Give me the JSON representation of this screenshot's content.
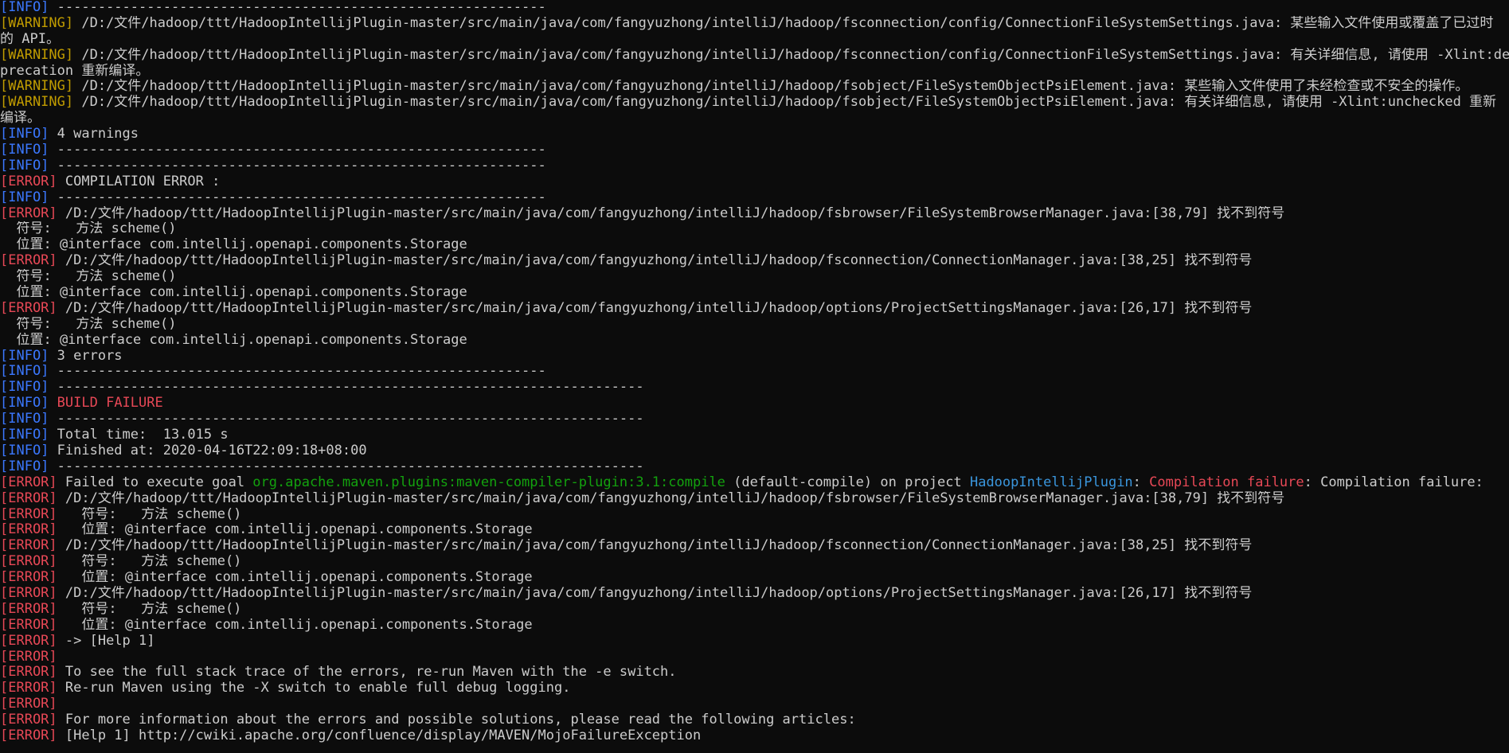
{
  "colors": {
    "background": "#0c0c0c",
    "text": "#cccccc",
    "info": "#3b78ff",
    "warning": "#c19c00",
    "error": "#e74856",
    "green": "#13a10e",
    "cyan": "#3a96dd"
  },
  "lines": [
    [
      {
        "c": "info",
        "t": "[INFO]"
      },
      {
        "c": "",
        "t": " ------------------------------------------------------------"
      }
    ],
    [
      {
        "c": "warn",
        "t": "[WARNING]"
      },
      {
        "c": "",
        "t": " /D:/文件/hadoop/ttt/HadoopIntellijPlugin-master/src/main/java/com/fangyuzhong/intelliJ/hadoop/fsconnection/config/ConnectionFileSystemSettings.java: 某些输入文件使用或覆盖了已过时"
      }
    ],
    [
      {
        "c": "",
        "t": "的 API。"
      }
    ],
    [
      {
        "c": "warn",
        "t": "[WARNING]"
      },
      {
        "c": "",
        "t": " /D:/文件/hadoop/ttt/HadoopIntellijPlugin-master/src/main/java/com/fangyuzhong/intelliJ/hadoop/fsconnection/config/ConnectionFileSystemSettings.java: 有关详细信息, 请使用 -Xlint:de"
      }
    ],
    [
      {
        "c": "",
        "t": "precation 重新编译。"
      }
    ],
    [
      {
        "c": "warn",
        "t": "[WARNING]"
      },
      {
        "c": "",
        "t": " /D:/文件/hadoop/ttt/HadoopIntellijPlugin-master/src/main/java/com/fangyuzhong/intelliJ/hadoop/fsobject/FileSystemObjectPsiElement.java: 某些输入文件使用了未经检查或不安全的操作。"
      }
    ],
    [
      {
        "c": "warn",
        "t": "[WARNING]"
      },
      {
        "c": "",
        "t": " /D:/文件/hadoop/ttt/HadoopIntellijPlugin-master/src/main/java/com/fangyuzhong/intelliJ/hadoop/fsobject/FileSystemObjectPsiElement.java: 有关详细信息, 请使用 -Xlint:unchecked 重新"
      }
    ],
    [
      {
        "c": "",
        "t": "编译。"
      }
    ],
    [
      {
        "c": "info",
        "t": "[INFO]"
      },
      {
        "c": "",
        "t": " 4 warnings"
      }
    ],
    [
      {
        "c": "info",
        "t": "[INFO]"
      },
      {
        "c": "",
        "t": " ------------------------------------------------------------"
      }
    ],
    [
      {
        "c": "info",
        "t": "[INFO]"
      },
      {
        "c": "",
        "t": " ------------------------------------------------------------"
      }
    ],
    [
      {
        "c": "error",
        "t": "[ERROR]"
      },
      {
        "c": "",
        "t": " COMPILATION ERROR :"
      }
    ],
    [
      {
        "c": "info",
        "t": "[INFO]"
      },
      {
        "c": "",
        "t": " ------------------------------------------------------------"
      }
    ],
    [
      {
        "c": "error",
        "t": "[ERROR]"
      },
      {
        "c": "",
        "t": " /D:/文件/hadoop/ttt/HadoopIntellijPlugin-master/src/main/java/com/fangyuzhong/intelliJ/hadoop/fsbrowser/FileSystemBrowserManager.java:[38,79] 找不到符号"
      }
    ],
    [
      {
        "c": "",
        "t": "  符号:   方法 scheme()"
      }
    ],
    [
      {
        "c": "",
        "t": "  位置: @interface com.intellij.openapi.components.Storage"
      }
    ],
    [
      {
        "c": "error",
        "t": "[ERROR]"
      },
      {
        "c": "",
        "t": " /D:/文件/hadoop/ttt/HadoopIntellijPlugin-master/src/main/java/com/fangyuzhong/intelliJ/hadoop/fsconnection/ConnectionManager.java:[38,25] 找不到符号"
      }
    ],
    [
      {
        "c": "",
        "t": "  符号:   方法 scheme()"
      }
    ],
    [
      {
        "c": "",
        "t": "  位置: @interface com.intellij.openapi.components.Storage"
      }
    ],
    [
      {
        "c": "error",
        "t": "[ERROR]"
      },
      {
        "c": "",
        "t": " /D:/文件/hadoop/ttt/HadoopIntellijPlugin-master/src/main/java/com/fangyuzhong/intelliJ/hadoop/options/ProjectSettingsManager.java:[26,17] 找不到符号"
      }
    ],
    [
      {
        "c": "",
        "t": "  符号:   方法 scheme()"
      }
    ],
    [
      {
        "c": "",
        "t": "  位置: @interface com.intellij.openapi.components.Storage"
      }
    ],
    [
      {
        "c": "info",
        "t": "[INFO]"
      },
      {
        "c": "",
        "t": " 3 errors"
      }
    ],
    [
      {
        "c": "info",
        "t": "[INFO]"
      },
      {
        "c": "",
        "t": " ------------------------------------------------------------"
      }
    ],
    [
      {
        "c": "info",
        "t": "[INFO]"
      },
      {
        "c": "",
        "t": " ------------------------------------------------------------------------"
      }
    ],
    [
      {
        "c": "info",
        "t": "[INFO]"
      },
      {
        "c": "",
        "t": " "
      },
      {
        "c": "bright-red",
        "t": "BUILD FAILURE"
      }
    ],
    [
      {
        "c": "info",
        "t": "[INFO]"
      },
      {
        "c": "",
        "t": " ------------------------------------------------------------------------"
      }
    ],
    [
      {
        "c": "info",
        "t": "[INFO]"
      },
      {
        "c": "",
        "t": " Total time:  13.015 s"
      }
    ],
    [
      {
        "c": "info",
        "t": "[INFO]"
      },
      {
        "c": "",
        "t": " Finished at: 2020-04-16T22:09:18+08:00"
      }
    ],
    [
      {
        "c": "info",
        "t": "[INFO]"
      },
      {
        "c": "",
        "t": " ------------------------------------------------------------------------"
      }
    ],
    [
      {
        "c": "error",
        "t": "[ERROR]"
      },
      {
        "c": "",
        "t": " Failed to execute goal "
      },
      {
        "c": "green",
        "t": "org.apache.maven.plugins:maven-compiler-plugin:3.1:compile"
      },
      {
        "c": "",
        "t": " (default-compile) on project "
      },
      {
        "c": "cyan",
        "t": "HadoopIntellijPlugin"
      },
      {
        "c": "",
        "t": ": "
      },
      {
        "c": "bright-red",
        "t": "Compilation failure"
      },
      {
        "c": "",
        "t": ": Compilation failure:"
      }
    ],
    [
      {
        "c": "error",
        "t": "[ERROR]"
      },
      {
        "c": "",
        "t": " /D:/文件/hadoop/ttt/HadoopIntellijPlugin-master/src/main/java/com/fangyuzhong/intelliJ/hadoop/fsbrowser/FileSystemBrowserManager.java:[38,79] 找不到符号"
      }
    ],
    [
      {
        "c": "error",
        "t": "[ERROR]"
      },
      {
        "c": "",
        "t": "   符号:   方法 scheme()"
      }
    ],
    [
      {
        "c": "error",
        "t": "[ERROR]"
      },
      {
        "c": "",
        "t": "   位置: @interface com.intellij.openapi.components.Storage"
      }
    ],
    [
      {
        "c": "error",
        "t": "[ERROR]"
      },
      {
        "c": "",
        "t": " /D:/文件/hadoop/ttt/HadoopIntellijPlugin-master/src/main/java/com/fangyuzhong/intelliJ/hadoop/fsconnection/ConnectionManager.java:[38,25] 找不到符号"
      }
    ],
    [
      {
        "c": "error",
        "t": "[ERROR]"
      },
      {
        "c": "",
        "t": "   符号:   方法 scheme()"
      }
    ],
    [
      {
        "c": "error",
        "t": "[ERROR]"
      },
      {
        "c": "",
        "t": "   位置: @interface com.intellij.openapi.components.Storage"
      }
    ],
    [
      {
        "c": "error",
        "t": "[ERROR]"
      },
      {
        "c": "",
        "t": " /D:/文件/hadoop/ttt/HadoopIntellijPlugin-master/src/main/java/com/fangyuzhong/intelliJ/hadoop/options/ProjectSettingsManager.java:[26,17] 找不到符号"
      }
    ],
    [
      {
        "c": "error",
        "t": "[ERROR]"
      },
      {
        "c": "",
        "t": "   符号:   方法 scheme()"
      }
    ],
    [
      {
        "c": "error",
        "t": "[ERROR]"
      },
      {
        "c": "",
        "t": "   位置: @interface com.intellij.openapi.components.Storage"
      }
    ],
    [
      {
        "c": "error",
        "t": "[ERROR]"
      },
      {
        "c": "",
        "t": " -> [Help 1]"
      }
    ],
    [
      {
        "c": "error",
        "t": "[ERROR]"
      }
    ],
    [
      {
        "c": "error",
        "t": "[ERROR]"
      },
      {
        "c": "",
        "t": " To see the full stack trace of the errors, re-run Maven with the -e switch."
      }
    ],
    [
      {
        "c": "error",
        "t": "[ERROR]"
      },
      {
        "c": "",
        "t": " Re-run Maven using the -X switch to enable full debug logging."
      }
    ],
    [
      {
        "c": "error",
        "t": "[ERROR]"
      }
    ],
    [
      {
        "c": "error",
        "t": "[ERROR]"
      },
      {
        "c": "",
        "t": " For more information about the errors and possible solutions, please read the following articles:"
      }
    ],
    [
      {
        "c": "error",
        "t": "[ERROR]"
      },
      {
        "c": "",
        "t": " [Help 1] http://cwiki.apache.org/confluence/display/MAVEN/MojoFailureException"
      }
    ]
  ]
}
